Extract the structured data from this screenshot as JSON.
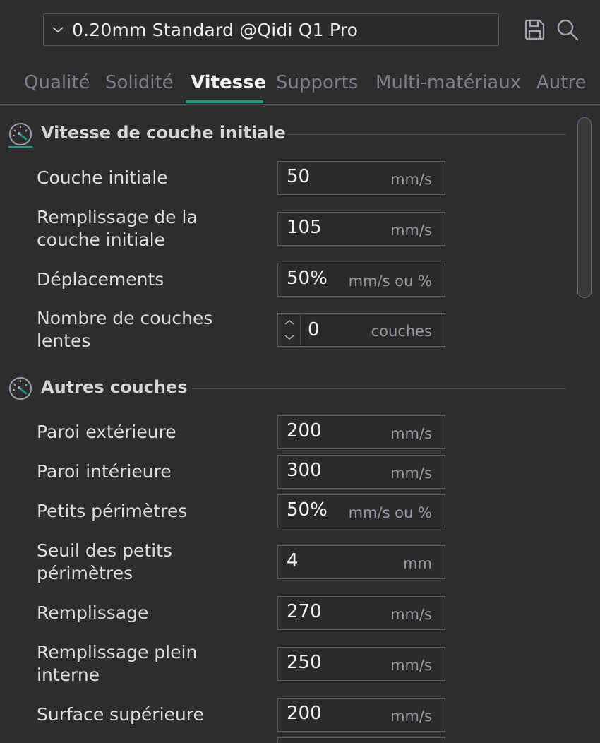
{
  "preset": {
    "name": "0.20mm Standard @Qidi Q1 Pro"
  },
  "tabs": [
    {
      "label": "Qualité"
    },
    {
      "label": "Solidité"
    },
    {
      "label": "Vitesse"
    },
    {
      "label": "Supports"
    },
    {
      "label": "Multi-matériaux"
    },
    {
      "label": "Autre"
    }
  ],
  "active_tab": "Vitesse",
  "accent_color": "#17a085",
  "sections": [
    {
      "title": "Vitesse de couche initiale",
      "icon": "speedometer-icon",
      "rows": [
        {
          "label": "Couche initiale",
          "value": "50",
          "unit": "mm/s"
        },
        {
          "label": "Remplissage de la couche initiale",
          "value": "105",
          "unit": "mm/s"
        },
        {
          "label": "Déplacements",
          "value": "50%",
          "unit": "mm/s ou %"
        },
        {
          "label": "Nombre de couches lentes",
          "value": "0",
          "unit": "couches"
        }
      ]
    },
    {
      "title": "Autres couches",
      "icon": "speedometer-icon",
      "rows": [
        {
          "label": "Paroi extérieure",
          "value": "200",
          "unit": "mm/s"
        },
        {
          "label": "Paroi intérieure",
          "value": "300",
          "unit": "mm/s"
        },
        {
          "label": "Petits périmètres",
          "value": "50%",
          "unit": "mm/s ou %"
        },
        {
          "label": "Seuil des petits périmètres",
          "value": "4",
          "unit": "mm"
        },
        {
          "label": "Remplissage",
          "value": "270",
          "unit": "mm/s"
        },
        {
          "label": "Remplissage plein interne",
          "value": "250",
          "unit": "mm/s"
        },
        {
          "label": "Surface supérieure",
          "value": "200",
          "unit": "mm/s"
        }
      ]
    }
  ]
}
